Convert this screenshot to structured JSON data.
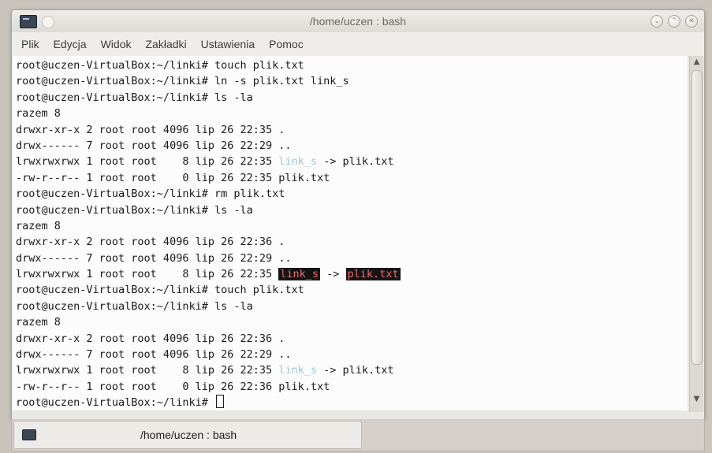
{
  "window": {
    "title": "/home/uczen : bash",
    "icon": "terminal-icon"
  },
  "menu": [
    "Plik",
    "Edycja",
    "Widok",
    "Zakładki",
    "Ustawienia",
    "Pomoc"
  ],
  "colors": {
    "terminal_bg": "#fcfcfc",
    "terminal_fg": "#1a1a1a",
    "symlink": "#9bc8d6",
    "broken_link_fg": "#f06a6a",
    "broken_link_bg": "#141414"
  },
  "terminal": {
    "lines": [
      {
        "segments": [
          {
            "t": "root@uczen-VirtualBox:~/linki# touch plik.txt"
          }
        ]
      },
      {
        "segments": [
          {
            "t": "root@uczen-VirtualBox:~/linki# ln -s plik.txt link_s"
          }
        ]
      },
      {
        "segments": [
          {
            "t": "root@uczen-VirtualBox:~/linki# ls -la"
          }
        ]
      },
      {
        "segments": [
          {
            "t": "razem 8"
          }
        ]
      },
      {
        "segments": [
          {
            "t": "drwxr-xr-x 2 root root 4096 lip 26 22:35 ."
          }
        ]
      },
      {
        "segments": [
          {
            "t": "drwx------ 7 root root 4096 lip 26 22:29 .."
          }
        ]
      },
      {
        "segments": [
          {
            "t": "lrwxrwxrwx 1 root root    8 lip 26 22:35 "
          },
          {
            "t": "link_s",
            "c": "link"
          },
          {
            "t": " -> plik.txt"
          }
        ]
      },
      {
        "segments": [
          {
            "t": "-rw-r--r-- 1 root root    0 lip 26 22:35 plik.txt"
          }
        ]
      },
      {
        "segments": [
          {
            "t": "root@uczen-VirtualBox:~/linki# rm plik.txt"
          }
        ]
      },
      {
        "segments": [
          {
            "t": "root@uczen-VirtualBox:~/linki# ls -la"
          }
        ]
      },
      {
        "segments": [
          {
            "t": "razem 8"
          }
        ]
      },
      {
        "segments": [
          {
            "t": "drwxr-xr-x 2 root root 4096 lip 26 22:36 ."
          }
        ]
      },
      {
        "segments": [
          {
            "t": "drwx------ 7 root root 4096 lip 26 22:29 .."
          }
        ]
      },
      {
        "segments": [
          {
            "t": "lrwxrwxrwx 1 root root    8 lip 26 22:35 "
          },
          {
            "t": "link_s",
            "c": "broken"
          },
          {
            "t": " -> "
          },
          {
            "t": "plik.txt",
            "c": "broken"
          }
        ]
      },
      {
        "segments": [
          {
            "t": "root@uczen-VirtualBox:~/linki# touch plik.txt"
          }
        ]
      },
      {
        "segments": [
          {
            "t": "root@uczen-VirtualBox:~/linki# ls -la"
          }
        ]
      },
      {
        "segments": [
          {
            "t": "razem 8"
          }
        ]
      },
      {
        "segments": [
          {
            "t": "drwxr-xr-x 2 root root 4096 lip 26 22:36 ."
          }
        ]
      },
      {
        "segments": [
          {
            "t": "drwx------ 7 root root 4096 lip 26 22:29 .."
          }
        ]
      },
      {
        "segments": [
          {
            "t": "lrwxrwxrwx 1 root root    8 lip 26 22:35 "
          },
          {
            "t": "link_s",
            "c": "link"
          },
          {
            "t": " -> plik.txt"
          }
        ]
      },
      {
        "segments": [
          {
            "t": "-rw-r--r-- 1 root root    0 lip 26 22:36 plik.txt"
          }
        ]
      },
      {
        "segments": [
          {
            "t": "root@uczen-VirtualBox:~/linki# "
          }
        ],
        "cursor": true
      }
    ]
  },
  "tab": {
    "label": "/home/uczen : bash",
    "icon": "terminal-icon"
  }
}
